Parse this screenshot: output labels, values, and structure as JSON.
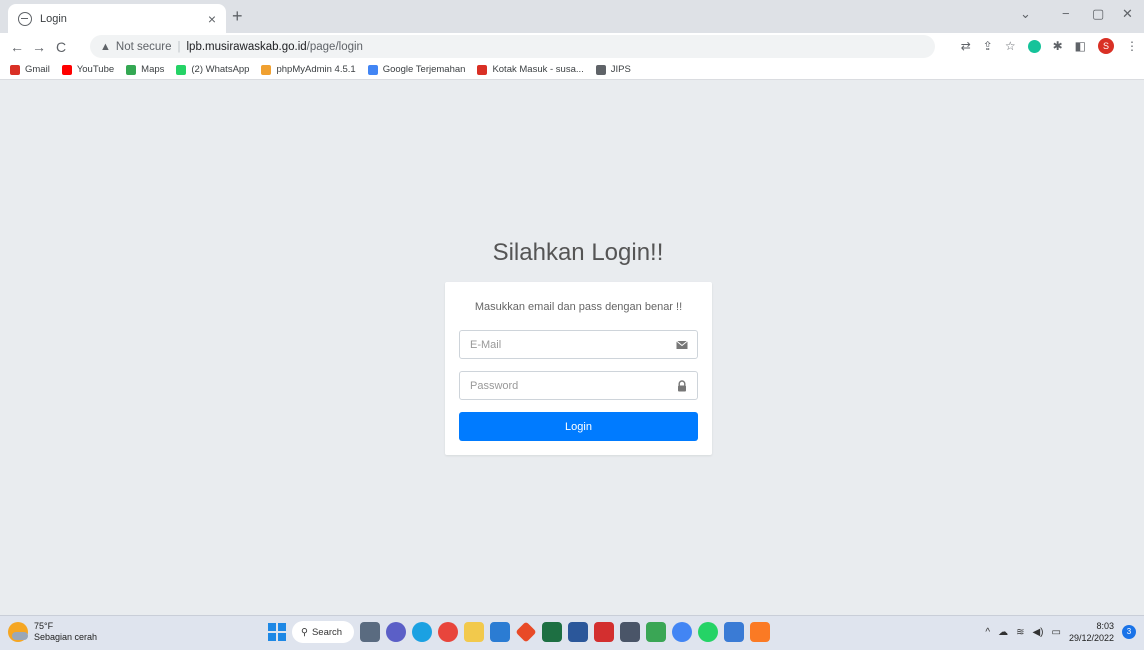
{
  "browser": {
    "tab_title": "Login",
    "tab_close": "×",
    "new_tab": "+",
    "win_min": "−",
    "win_restore": "▢",
    "win_close": "✕",
    "win_dropdown": "⌄",
    "back": "←",
    "forward": "→",
    "reload": "C",
    "security_icon": "▲",
    "security_label": "Not secure",
    "url_domain": "lpb.musirawaskab.go.id",
    "url_path": "/page/login",
    "profile_initial": "S",
    "bookmarks": [
      {
        "label": "Gmail",
        "icon": "gmail-icon",
        "color": "#d93025"
      },
      {
        "label": "YouTube",
        "icon": "youtube-icon",
        "color": "#ff0000"
      },
      {
        "label": "Maps",
        "icon": "maps-icon",
        "color": "#34a853"
      },
      {
        "label": "(2) WhatsApp",
        "icon": "whatsapp-icon",
        "color": "#25d366"
      },
      {
        "label": "phpMyAdmin 4.5.1",
        "icon": "phpmyadmin-icon",
        "color": "#f0a030"
      },
      {
        "label": "Google Terjemahan",
        "icon": "translate-icon",
        "color": "#4285f4"
      },
      {
        "label": "Kotak Masuk - susa...",
        "icon": "gmail-icon",
        "color": "#d93025"
      },
      {
        "label": "JIPS",
        "icon": "book-icon",
        "color": "#5f6368"
      }
    ]
  },
  "login": {
    "title": "Silahkan Login!!",
    "message": "Masukkan email dan pass dengan benar !!",
    "email_placeholder": "E-Mail",
    "password_placeholder": "Password",
    "button_label": "Login",
    "accent_color": "#007bff"
  },
  "taskbar": {
    "temperature": "75°F",
    "weather_desc": "Sebagian cerah",
    "search_label": "Search",
    "time": "8:03",
    "date": "29/12/2022",
    "notification_count": "3",
    "tray_chevron": "^"
  }
}
